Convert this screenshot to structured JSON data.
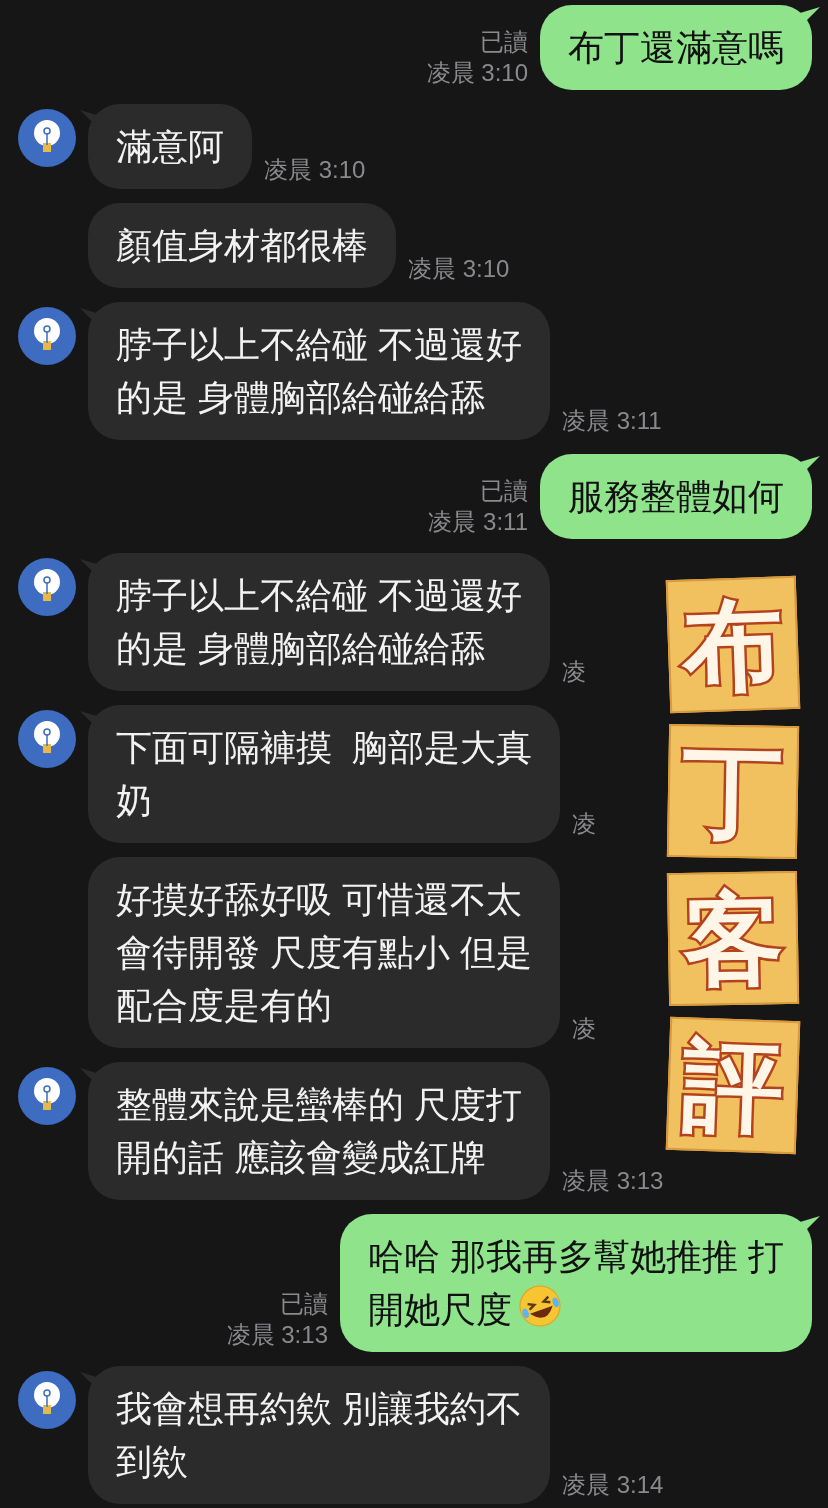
{
  "messages": [
    {
      "kind": "outgoing",
      "lines": [
        "布丁還滿意嗎"
      ],
      "read_label": "已讀",
      "time": "凌晨 3:10"
    },
    {
      "kind": "incoming",
      "avatar": true,
      "lines": [
        "滿意阿"
      ],
      "time": "凌晨 3:10"
    },
    {
      "kind": "incoming",
      "avatar": false,
      "lines": [
        "顏值身材都很棒"
      ],
      "time": "凌晨 3:10"
    },
    {
      "kind": "incoming",
      "avatar": true,
      "lines": [
        "脖子以上不給碰 不過還好",
        "的是 身體胸部給碰給舔"
      ],
      "time": "凌晨 3:11"
    },
    {
      "kind": "outgoing",
      "lines": [
        "服務整體如何"
      ],
      "read_label": "已讀",
      "time": "凌晨 3:11"
    },
    {
      "kind": "incoming",
      "avatar": true,
      "lines": [
        "脖子以上不給碰 不過還好",
        "的是 身體胸部給碰給舔"
      ],
      "time": "凌"
    },
    {
      "kind": "incoming",
      "avatar": true,
      "lines": [
        "下面可隔褲摸  胸部是大真",
        "奶"
      ],
      "time": "凌"
    },
    {
      "kind": "incoming",
      "avatar": false,
      "lines": [
        "好摸好舔好吸 可惜還不太",
        "會待開發 尺度有點小 但是",
        "配合度是有的"
      ],
      "time": "凌"
    },
    {
      "kind": "incoming",
      "avatar": true,
      "lines": [
        "整體來說是蠻棒的 尺度打",
        "開的話 應該會變成紅牌"
      ],
      "time": "凌晨 3:13"
    },
    {
      "kind": "outgoing",
      "lines": [
        "哈哈 那我再多幫她推推 打",
        "開她尺度"
      ],
      "has_emoji": true,
      "read_label": "已讀",
      "time": "凌晨 3:13"
    },
    {
      "kind": "incoming",
      "avatar": true,
      "lines": [
        "我會想再約欸 別讓我約不",
        "到欸"
      ],
      "time": "凌晨 3:14"
    }
  ],
  "sticker": {
    "chars": [
      "布",
      "丁",
      "客",
      "評"
    ]
  }
}
